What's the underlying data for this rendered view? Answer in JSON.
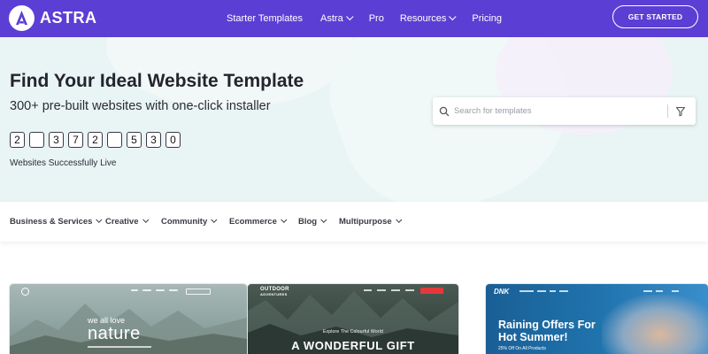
{
  "header": {
    "logo_text": "ASTRA",
    "nav": [
      {
        "label": "Starter Templates",
        "dropdown": false
      },
      {
        "label": "Astra",
        "dropdown": true
      },
      {
        "label": "Pro",
        "dropdown": false
      },
      {
        "label": "Resources",
        "dropdown": true
      },
      {
        "label": "Pricing",
        "dropdown": false
      }
    ],
    "cta_label": "GET STARTED",
    "brand_color": "#5b3fd4"
  },
  "hero": {
    "title": "Find Your Ideal Website Template",
    "subtitle": "300+ pre-built websites with one-click installer",
    "counter_digits": [
      "2",
      "",
      "3",
      "7",
      "2",
      "",
      "5",
      "3",
      "0"
    ],
    "counter_label": "Websites Successfully Live",
    "search": {
      "placeholder": "Search for templates",
      "value": "",
      "icon": "search-icon",
      "filter_icon": "filter-icon"
    }
  },
  "categories": [
    {
      "label": "Business & Services"
    },
    {
      "label": "Creative"
    },
    {
      "label": "Community"
    },
    {
      "label": "Ecommerce"
    },
    {
      "label": "Blog"
    },
    {
      "label": "Multipurpose"
    }
  ],
  "cards": [
    {
      "small_text": "we all love",
      "big_text": "nature"
    },
    {
      "logo_line1": "OUTDOOR",
      "logo_line2": "ADVENTURES",
      "small_text": "Explore The Colourful World",
      "big_text": "A WONDERFUL GIFT"
    },
    {
      "logo": "DNK",
      "big_text_line1": "Raining Offers For",
      "big_text_line2": "Hot Summer!",
      "small_text": "25% Off On All Products"
    }
  ]
}
